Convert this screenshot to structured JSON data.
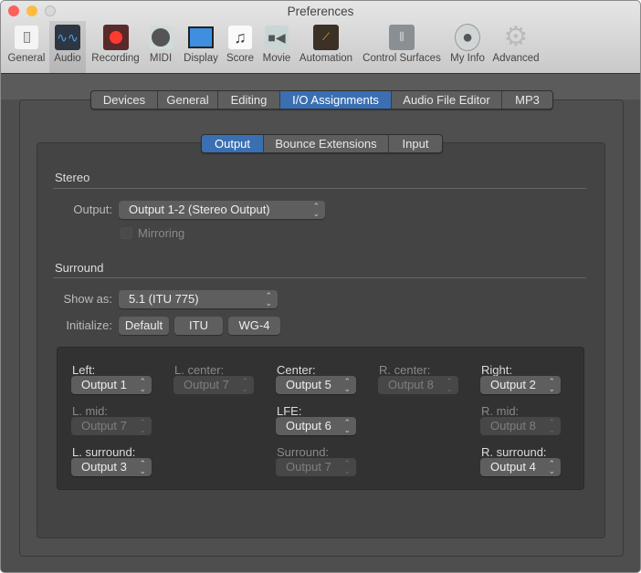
{
  "window": {
    "title": "Preferences"
  },
  "toolbar": [
    {
      "label": "General",
      "icon": "switch-icon"
    },
    {
      "label": "Audio",
      "icon": "waveform-icon",
      "selected": true
    },
    {
      "label": "Recording",
      "icon": "record-icon"
    },
    {
      "label": "MIDI",
      "icon": "midi-port-icon"
    },
    {
      "label": "Display",
      "icon": "monitor-icon"
    },
    {
      "label": "Score",
      "icon": "music-note-icon"
    },
    {
      "label": "Movie",
      "icon": "video-camera-icon"
    },
    {
      "label": "Automation",
      "icon": "automation-curve-icon"
    },
    {
      "label": "Control Surfaces",
      "icon": "faders-icon"
    },
    {
      "label": "My Info",
      "icon": "person-icon"
    },
    {
      "label": "Advanced",
      "icon": "gear-icon"
    }
  ],
  "tabs": [
    "Devices",
    "General",
    "Editing",
    "I/O Assignments",
    "Audio File Editor",
    "MP3"
  ],
  "active_tab": "I/O Assignments",
  "subtabs": [
    "Output",
    "Bounce Extensions",
    "Input"
  ],
  "active_subtab": "Output",
  "stereo": {
    "heading": "Stereo",
    "output_label": "Output:",
    "output_value": "Output 1-2 (Stereo Output)",
    "mirroring_label": "Mirroring",
    "mirroring_checked": false
  },
  "surround": {
    "heading": "Surround",
    "show_as_label": "Show as:",
    "show_as_value": "5.1 (ITU 775)",
    "initialize_label": "Initialize:",
    "buttons": [
      "Default",
      "ITU",
      "WG-4"
    ]
  },
  "channels": [
    {
      "label": "Left:",
      "value": "Output 1",
      "enabled": true
    },
    {
      "label": "L. center:",
      "value": "Output 7",
      "enabled": false
    },
    {
      "label": "Center:",
      "value": "Output 5",
      "enabled": true
    },
    {
      "label": "R. center:",
      "value": "Output 8",
      "enabled": false
    },
    {
      "label": "Right:",
      "value": "Output 2",
      "enabled": true
    },
    {
      "label": "L. mid:",
      "value": "Output 7",
      "enabled": false
    },
    {
      "label": "LFE:",
      "value": "Output 6",
      "enabled": true
    },
    {
      "label": "R. mid:",
      "value": "Output 8",
      "enabled": false
    },
    {
      "label": "L. surround:",
      "value": "Output 3",
      "enabled": true
    },
    {
      "label": "Surround:",
      "value": "Output 7",
      "enabled": false
    },
    {
      "label": "R. surround:",
      "value": "Output 4",
      "enabled": true
    }
  ]
}
